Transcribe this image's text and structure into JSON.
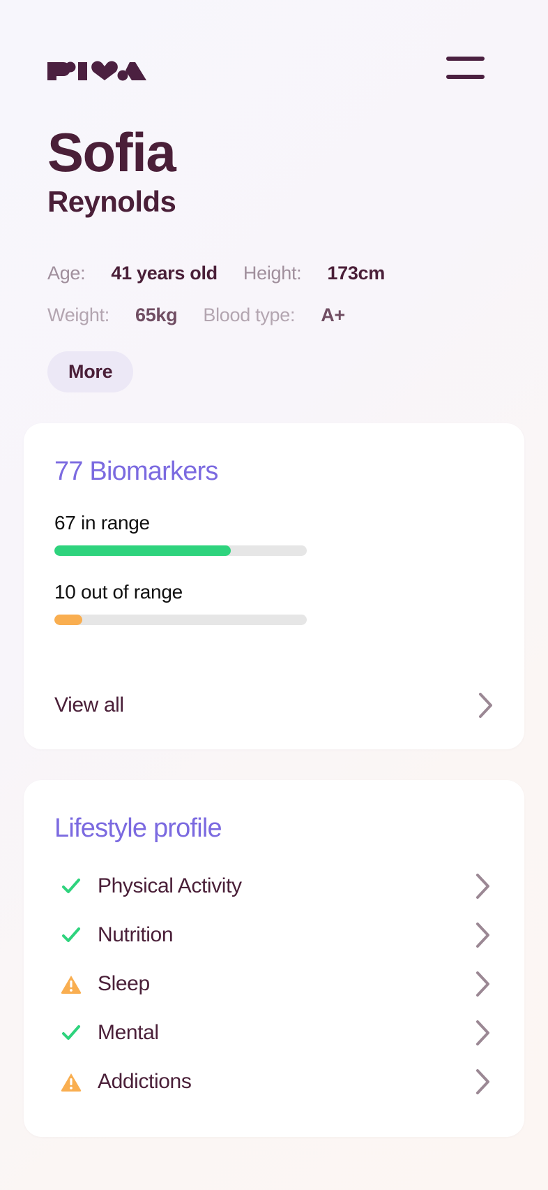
{
  "brand": {
    "logo_text": "riva",
    "logo_color": "#4b2040"
  },
  "header": {
    "menu_label": "menu"
  },
  "profile": {
    "first_name": "Sofia",
    "last_name": "Reynolds",
    "stats": [
      [
        {
          "label": "Age:",
          "value": "41 years old"
        },
        {
          "label": "Height:",
          "value": "173cm"
        }
      ],
      [
        {
          "label": "Weight:",
          "value": "65kg"
        },
        {
          "label": "Blood type:",
          "value": "A+"
        }
      ]
    ],
    "more_label": "More"
  },
  "biomarkers_card": {
    "title": "77 Biomarkers",
    "in_range_label": "67 in range",
    "in_range_percent": 70,
    "in_range_color": "#2ed37d",
    "out_of_range_label": "10 out of range",
    "out_of_range_percent": 11,
    "out_of_range_color": "#f9ae50",
    "track_color": "#e6e6e6",
    "view_all_label": "View all"
  },
  "lifestyle_card": {
    "title": "Lifestyle profile",
    "items": [
      {
        "label": "Physical Activity",
        "status": "check"
      },
      {
        "label": "Nutrition",
        "status": "check"
      },
      {
        "label": "Sleep",
        "status": "warning"
      },
      {
        "label": "Mental",
        "status": "check"
      },
      {
        "label": "Addictions",
        "status": "warning"
      }
    ],
    "check_color": "#2ed37d",
    "warning_color": "#f9ae50"
  },
  "accent": {
    "purple": "#7b6ae0",
    "maroon": "#4a1f38",
    "muted": "#a08f9c",
    "pill_bg": "#ece8f6"
  }
}
